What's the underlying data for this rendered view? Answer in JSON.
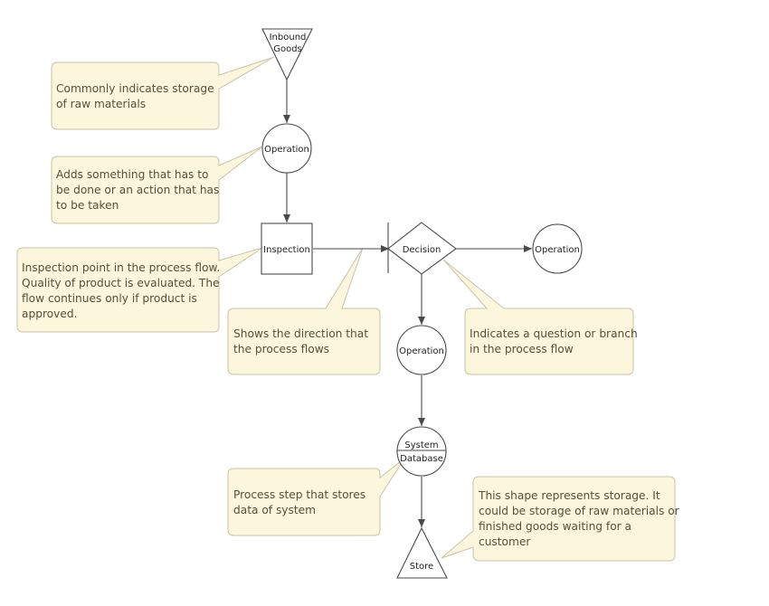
{
  "diagram": {
    "type": "process-flow",
    "colors": {
      "callout_fill": "#fbf6dc",
      "callout_border": "#c9c3a8",
      "callout_text": "#5a4e3a",
      "node_stroke": "#4a4a4a",
      "node_fill": "#ffffff"
    },
    "nodes": {
      "inbound": {
        "shape": "inverted-triangle",
        "lines": [
          "Inbound",
          "Goods"
        ]
      },
      "operation1": {
        "shape": "circle",
        "label": "Operation"
      },
      "inspection": {
        "shape": "square",
        "label": "Inspection"
      },
      "decision": {
        "shape": "diamond",
        "label": "Decision"
      },
      "operation_right": {
        "shape": "circle",
        "label": "Operation"
      },
      "operation2": {
        "shape": "circle",
        "label": "Operation"
      },
      "database": {
        "shape": "split-circle",
        "lines": [
          "System",
          "Database"
        ]
      },
      "store": {
        "shape": "triangle",
        "label": "Store"
      }
    },
    "edges": [
      {
        "from": "inbound",
        "to": "operation1"
      },
      {
        "from": "operation1",
        "to": "inspection"
      },
      {
        "from": "inspection",
        "to": "decision"
      },
      {
        "from": "decision",
        "to": "operation_right"
      },
      {
        "from": "decision",
        "to": "operation2"
      },
      {
        "from": "operation2",
        "to": "database"
      },
      {
        "from": "database",
        "to": "store"
      }
    ],
    "callouts": {
      "storage_raw": {
        "target": "inbound",
        "lines": [
          "Commonly indicates storage",
          "of raw materials"
        ]
      },
      "operation": {
        "target": "operation1",
        "lines": [
          "Adds something that has to",
          "be done or an action that has",
          "to be taken"
        ]
      },
      "inspection": {
        "target": "inspection",
        "lines": [
          "Inspection point in the process flow.",
          "Quality of product is evaluated. The",
          "flow continues only if product is",
          "approved."
        ]
      },
      "direction": {
        "target": "inspection-to-decision-arrow",
        "lines": [
          "Shows the direction that",
          "the process flows"
        ]
      },
      "decision": {
        "target": "decision",
        "lines": [
          "Indicates a question or branch",
          "in the process flow"
        ]
      },
      "database": {
        "target": "database",
        "lines": [
          "Process step that stores",
          "data of system"
        ]
      },
      "store": {
        "target": "store",
        "lines": [
          "This shape represents storage. It",
          "could be storage of raw materials or",
          "finished goods waiting for a",
          "customer"
        ]
      }
    }
  }
}
